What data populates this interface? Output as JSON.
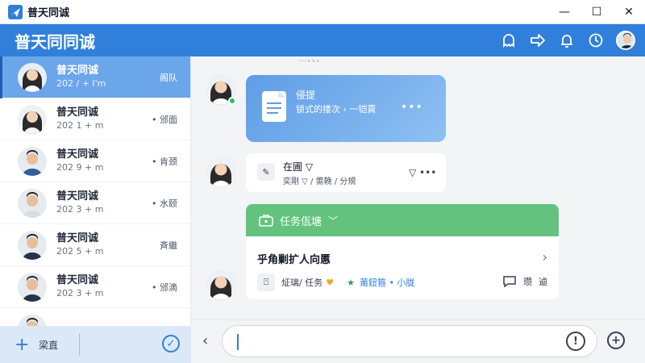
{
  "window": {
    "title": "普天同诚",
    "controls": {
      "minimize": "—",
      "maximize": "☐",
      "close": "✕"
    }
  },
  "header": {
    "brand": "普天同同诚",
    "icons": [
      "ghost-icon",
      "forward-arrow-icon",
      "bell-icon",
      "timer-icon",
      "user-avatar"
    ]
  },
  "contacts": [
    {
      "name": "普天同诚",
      "sub": "202 / + I'm",
      "tag": "阁队"
    },
    {
      "name": "普天同诚",
      "sub": "202 1 + m",
      "tag": "• 邠面"
    },
    {
      "name": "普天同诚",
      "sub": "202 9 + m",
      "tag": "• 肯颈"
    },
    {
      "name": "普天同诚",
      "sub": "202 3 + m",
      "tag": "• 水颐"
    },
    {
      "name": "普天同诚",
      "sub": "202 5 + m",
      "tag": "斉繼"
    },
    {
      "name": "普天同诚",
      "sub": "202 3 + m",
      "tag": "• 邠滴"
    },
    {
      "name": "",
      "sub": "",
      "tag": ""
    }
  ],
  "sidebar_bottom": {
    "new_label": "梁直"
  },
  "chat": {
    "top_clip": "…、、、",
    "doc_card": {
      "title": "侵提",
      "sub": "锁式的搂次 ‹ 一铠賣",
      "more": "•••"
    },
    "status_card": {
      "title": "在圃 ▽",
      "sub": "奕剛 ▽ / 薷鞔 / 分規",
      "actions": "▽ •••"
    },
    "task_card": {
      "header": "任务佤塘",
      "title": "乎角剿扩人向慝",
      "meta_text": "炡璃/ 任务",
      "meta_link": "莆鈕箍 • 小胧",
      "tools": [
        "瓒",
        "逌"
      ]
    }
  },
  "composer": {
    "back": "‹"
  },
  "colors": {
    "accent": "#2f7fdb",
    "active_row": "#6ca6ea",
    "task_green": "#63c37e"
  }
}
